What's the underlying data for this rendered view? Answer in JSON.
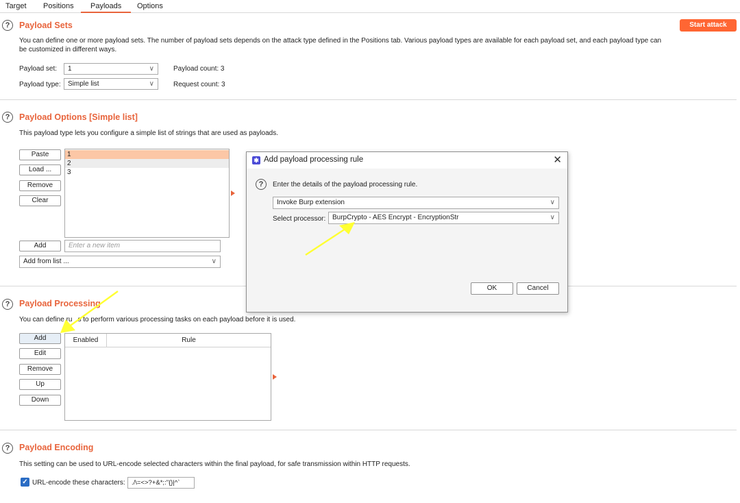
{
  "tabs": [
    {
      "label": "Target"
    },
    {
      "label": "Positions"
    },
    {
      "label": "Payloads"
    },
    {
      "label": "Options"
    }
  ],
  "start_attack_label": "Start attack",
  "payload_sets": {
    "title": "Payload Sets",
    "description_line1": "You can define one or more payload sets. The number of payload sets depends on the attack type defined in the Positions tab. Various payload types are available for each payload set, and each payload type can",
    "description_line2": "be customized in different ways.",
    "payload_set_label": "Payload set:",
    "payload_set_value": "1",
    "payload_count": "Payload count: 3",
    "payload_type_label": "Payload type:",
    "payload_type_value": "Simple list",
    "request_count": "Request count: 3"
  },
  "payload_options": {
    "title": "Payload Options [Simple list]",
    "description": "This payload type lets you configure a simple list of strings that are used as payloads.",
    "buttons": {
      "paste": "Paste",
      "load": "Load ...",
      "remove": "Remove",
      "clear": "Clear",
      "add": "Add"
    },
    "items": [
      "1",
      "2",
      "3"
    ],
    "new_item_placeholder": "Enter a new item",
    "add_from_list": "Add from list ..."
  },
  "payload_processing": {
    "title": "Payload Processing",
    "description_a": "You can define ru",
    "description_b": "s to perform various processing tasks on each payload before it is used.",
    "buttons": {
      "add": "Add",
      "edit": "Edit",
      "remove": "Remove",
      "up": "Up",
      "down": "Down"
    },
    "columns": {
      "enabled": "Enabled",
      "rule": "Rule"
    }
  },
  "payload_encoding": {
    "title": "Payload Encoding",
    "description": "This setting can be used to URL-encode selected characters within the final payload, for safe transmission within HTTP requests.",
    "checkbox_label": "URL-encode these characters:",
    "characters": "./\\=<>?+&*;:\"{}|^`"
  },
  "dialog": {
    "title": "Add payload processing rule",
    "instruction": "Enter the details of the payload processing rule.",
    "rule_type": "Invoke Burp extension",
    "processor_label": "Select processor:",
    "processor_value": "BurpCrypto - AES Encrypt - EncryptionStr",
    "ok": "OK",
    "cancel": "Cancel"
  },
  "icons": {
    "help": "question-circle-icon",
    "dropdown": "chevron-down-icon",
    "close": "close-icon",
    "expand": "triangle-right-icon",
    "check": "checkmark-icon"
  },
  "colors": {
    "accent": "#e8643c",
    "start_attack": "#ff6633",
    "selected_row": "#fcc7a6",
    "checkbox": "#2a6cc4",
    "annotation_arrow": "#ffff33"
  }
}
